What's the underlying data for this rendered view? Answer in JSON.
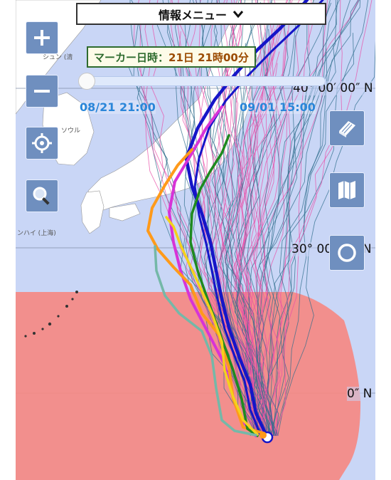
{
  "menu": {
    "label": "情報メニュー",
    "chevron_icon": "chevron-down-icon"
  },
  "marker": {
    "prefix": "マーカー日時：",
    "value": "21日 21時00分"
  },
  "slider": {
    "start_label": "08/21 21:00",
    "end_label": "09/01 15:00",
    "position_fraction": 0.0
  },
  "map_tags": {
    "left_place_1": "シュン (清",
    "place_seoul": "ソウル",
    "place_shanghai": "ンハイ (上海)"
  },
  "latitude_labels": {
    "lat40": "40° 00′ 00″ N",
    "lat30": "30° 00′ 00″ N",
    "lat20": "0″ N"
  },
  "controls": {
    "zoom_in": "plus-icon",
    "zoom_out": "minus-icon",
    "locate": "crosshair-icon",
    "search": "magnifier-icon",
    "legend": "book-icon",
    "map_layer": "map-icon",
    "circle": "circle-icon"
  },
  "colors": {
    "sea": "#c9d6f6",
    "land": "#ffffff",
    "warning_area": "#f58a84",
    "ensemble_pink": "#e84fa8",
    "ensemble_steel": "#2f6e8c",
    "track_blue": "#1515c8",
    "track_magenta": "#d733d7",
    "track_orange": "#ff9a1a",
    "track_green": "#1f8a1f",
    "track_yellow": "#f4d11c",
    "track_teal": "#74b8a8"
  }
}
